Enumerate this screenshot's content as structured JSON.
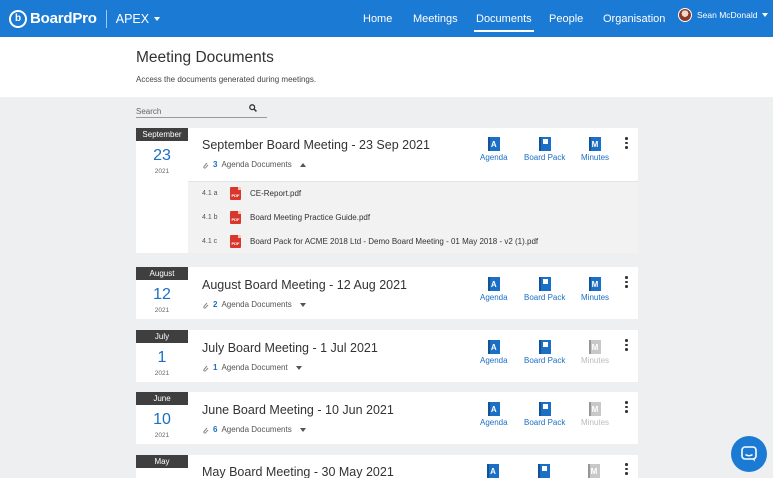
{
  "topbar": {
    "logo_text": "BoardPro",
    "org_name": "APEX",
    "nav": [
      "Home",
      "Meetings",
      "Documents",
      "People",
      "Organisation"
    ],
    "user_name": "Sean McDonald"
  },
  "header": {
    "title": "Meeting Documents",
    "subtitle": "Access the documents generated during meetings."
  },
  "search": {
    "placeholder": "Search"
  },
  "actions": {
    "agenda": "Agenda",
    "board_pack": "Board Pack",
    "minutes": "Minutes"
  },
  "meetings": [
    {
      "month": "September",
      "day": "23",
      "year": "2021",
      "title": "September Board Meeting - 23 Sep 2021",
      "doc_count": "3",
      "doc_label": "Agenda Documents",
      "minutes_available": true
    },
    {
      "month": "August",
      "day": "12",
      "year": "2021",
      "title": "August Board Meeting - 12 Aug 2021",
      "doc_count": "2",
      "doc_label": "Agenda Documents",
      "minutes_available": true
    },
    {
      "month": "July",
      "day": "1",
      "year": "2021",
      "title": "July Board Meeting - 1 Jul 2021",
      "doc_count": "1",
      "doc_label": "Agenda Document",
      "minutes_available": false
    },
    {
      "month": "June",
      "day": "10",
      "year": "2021",
      "title": "June Board Meeting - 10 Jun 2021",
      "doc_count": "6",
      "doc_label": "Agenda Documents",
      "minutes_available": false
    },
    {
      "month": "May",
      "title": "May Board Meeting - 30 May 2021",
      "minutes_available": false
    }
  ],
  "expanded_docs": [
    {
      "num": "4.1 a",
      "name": "CE-Report.pdf"
    },
    {
      "num": "4.1 b",
      "name": "Board Meeting Practice Guide.pdf"
    },
    {
      "num": "4.1 c",
      "name": "Board Pack for ACME 2018 Ltd - Demo Board Meeting - 01 May 2018 - v2 (1).pdf"
    }
  ],
  "icons": {
    "agenda_letter": "A",
    "minutes_letter": "M",
    "pdf_label": "PDF"
  },
  "colors": {
    "brand": "#1b7ad3",
    "link": "#1b6fc4",
    "month_bar": "#3f3f3f",
    "pdf": "#d9372b",
    "disabled": "#c8c8c8"
  }
}
